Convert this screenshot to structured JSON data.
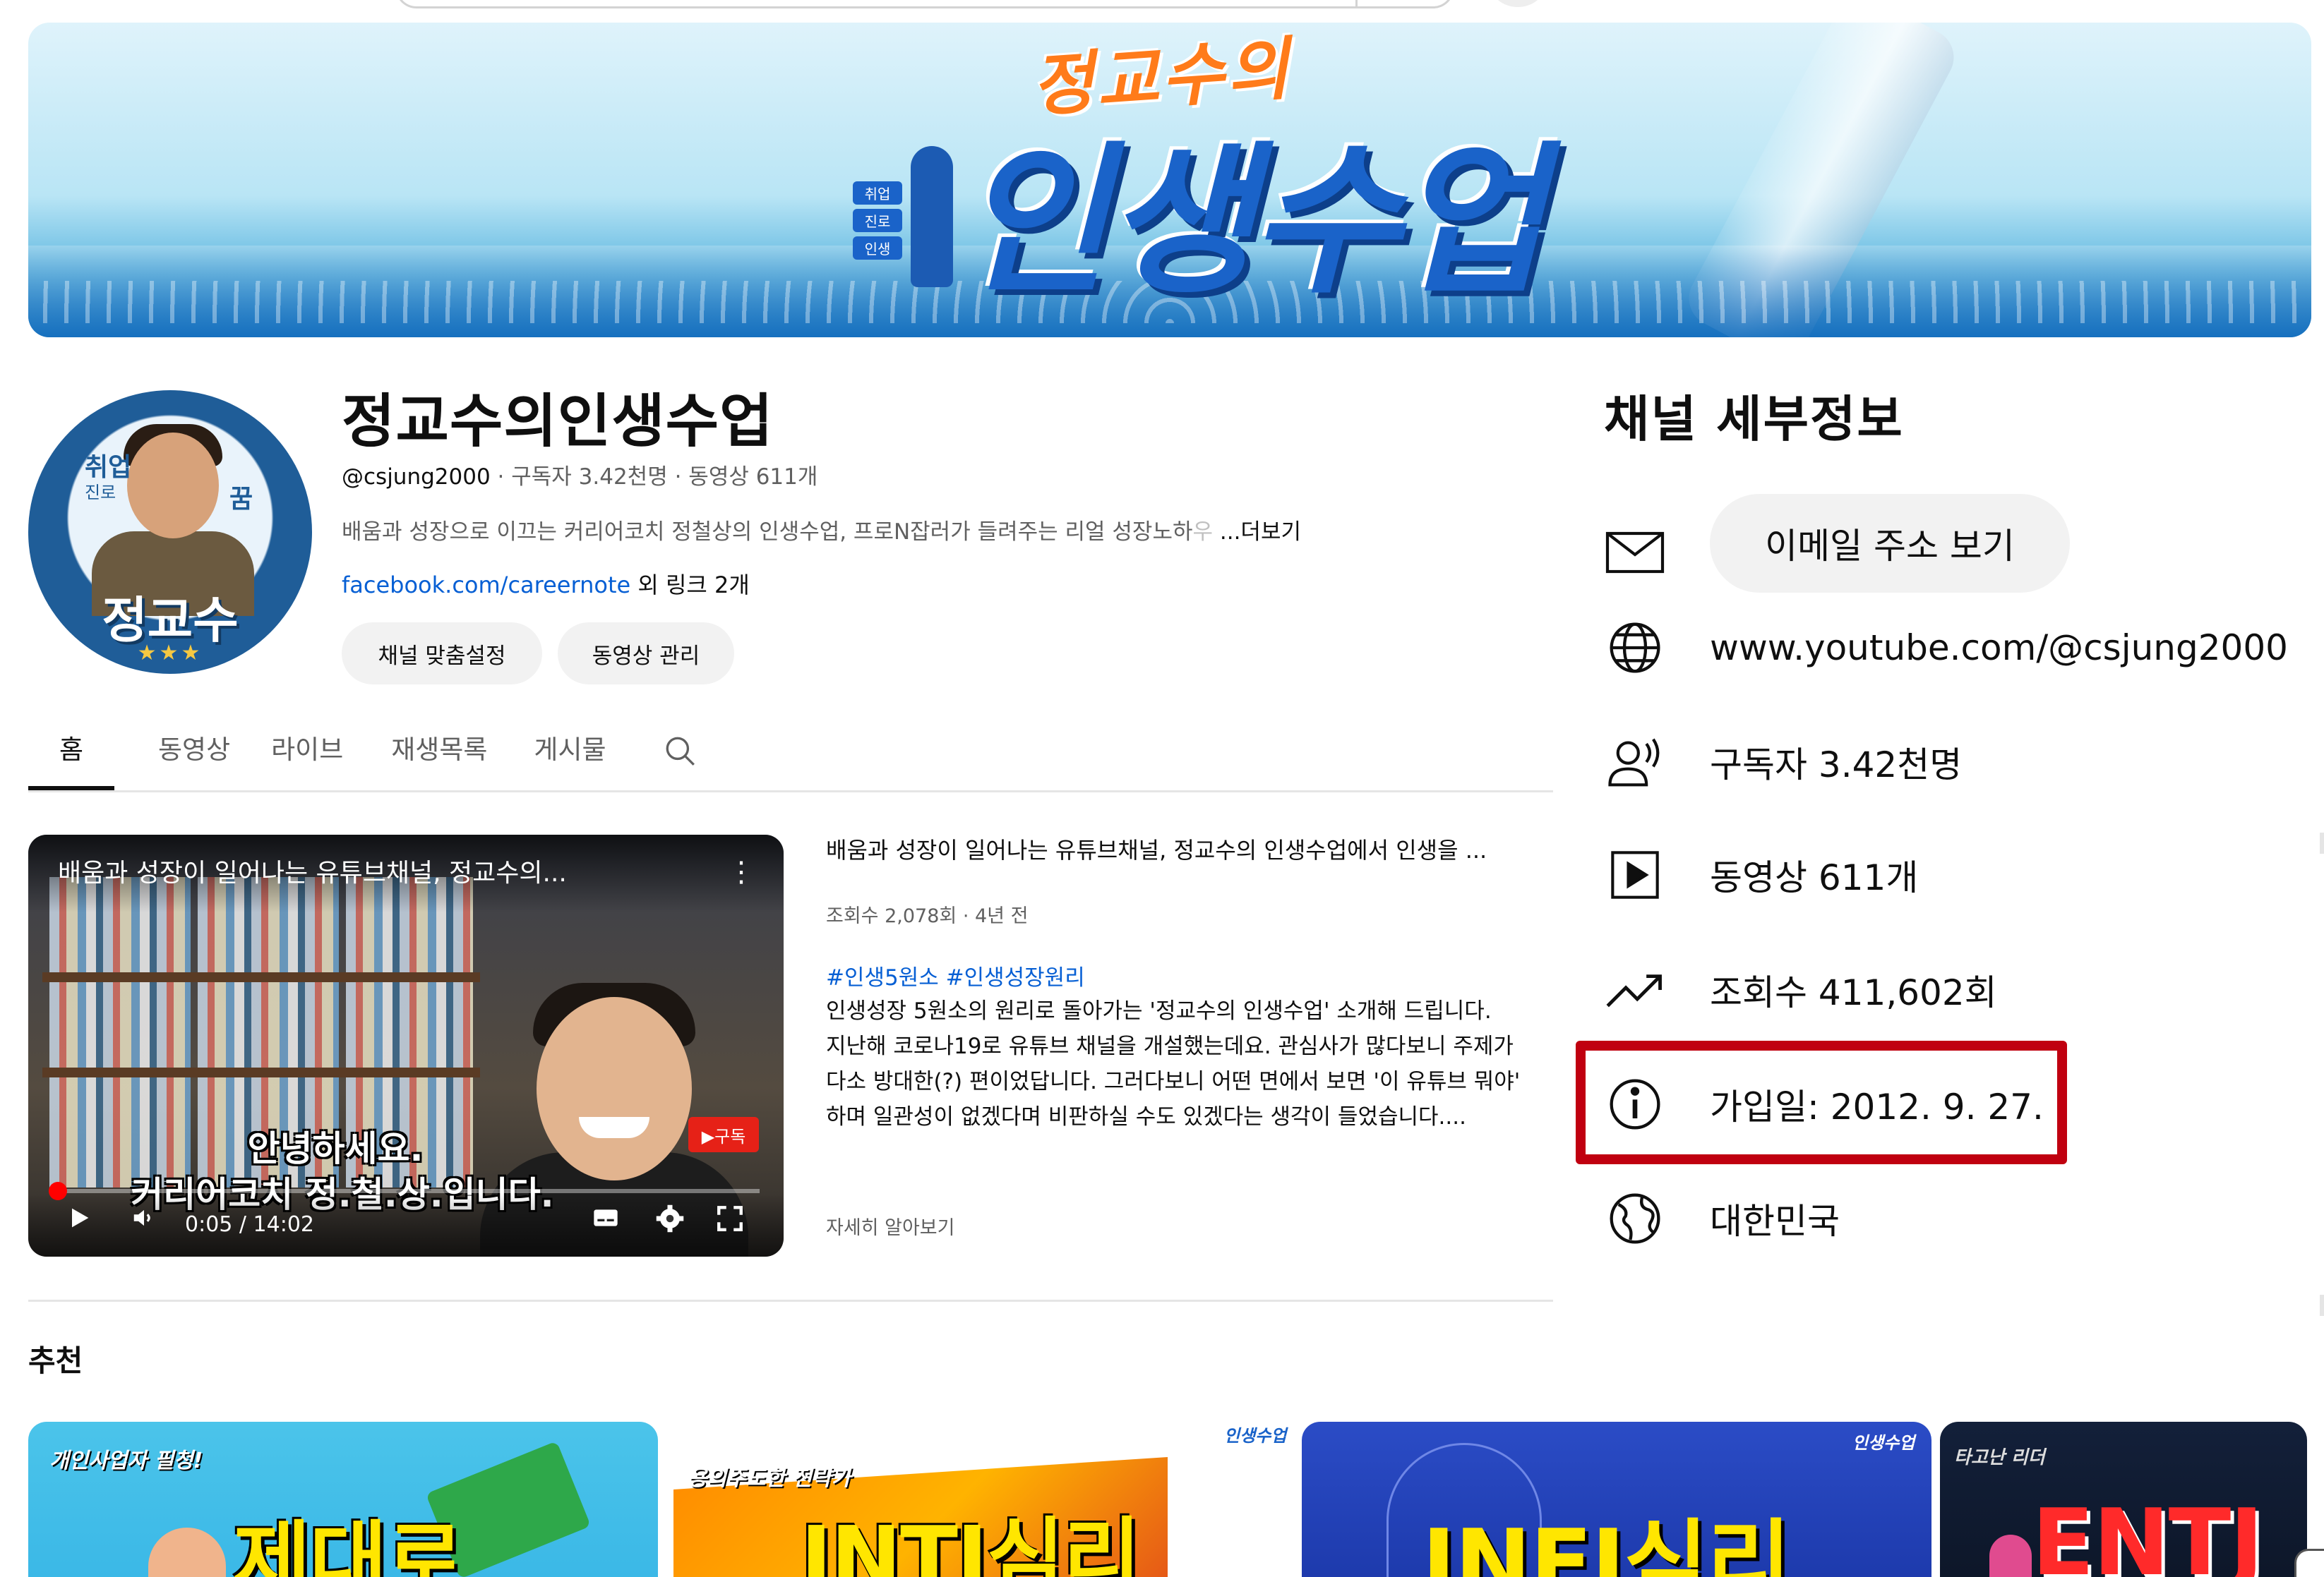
{
  "banner": {
    "subtitle": "정교수의",
    "main_title": "인생수업",
    "sign_labels": [
      "취업",
      "진로",
      "인생"
    ]
  },
  "avatar": {
    "tag_job": "취업",
    "tag_path": "진로",
    "tag_dream": "꿈",
    "name": "정교수",
    "stars": "★★★"
  },
  "channel": {
    "title": "정교수의인생수업",
    "handle": "@csjung2000",
    "subscribers": " · 구독자 3.42천명",
    "video_count": " · 동영상 611개",
    "description": "배움과 성장으로 이끄는 커리어코치 정철상의 인생수업, 프로N잡러가 들려주는 리얼 성장노하",
    "description_fade": "우 ",
    "more_label": "...더보기",
    "link": "facebook.com/careernote",
    "extra_links": " 외 링크 2개",
    "customize_label": "채널 맞춤설정",
    "manage_label": "동영상 관리"
  },
  "tabs": [
    {
      "label": "홈",
      "active": true
    },
    {
      "label": "동영상"
    },
    {
      "label": "라이브"
    },
    {
      "label": "재생목록"
    },
    {
      "label": "게시물"
    }
  ],
  "featured": {
    "overlay_title": "배움과 성장이 일어나는 유튜브채널, 정교수의...",
    "subtitle_line1": "안녕하세요.",
    "subtitle_line2": "커리어코치 정.철.상.입니다.",
    "subscribe_badge": "▶구독",
    "time": "0:05 / 14:02",
    "progress": 0.006,
    "title": "배움과 성장이 일어나는 유튜브채널, 정교수의 인생수업에서 인생을 ...",
    "stats": "조회수 2,078회 · 4년 전",
    "tags": "#인생5원소 #인생성장원리",
    "desc_line1": "인생성장 5원소의 원리로 돌아가는 '정교수의 인생수업' 소개해 드립니다.",
    "desc_line2": "지난해 코로나19로 유튜브 채널을 개설했는데요. 관심사가 많다보니 주제가 다소 방대한(?) 편이었답니다. 그러다보니 어떤 면에서 보면 '이 유튜브 뭐야' 하며 일관성이 없겠다며 비판하실 수도 있겠다는 생각이 들었습니다....",
    "more_label": "자세히 알아보기"
  },
  "recommended": {
    "title": "추천",
    "cards": [
      {
        "kicker": "개인사업자 필청!",
        "big": "제대로"
      },
      {
        "kicker": "용의주도한 전략가",
        "big": "INTJ심리",
        "logo": "인생수업"
      },
      {
        "big": "INFJ심리",
        "logo": "인생수업"
      },
      {
        "kicker": "타고난 리더",
        "big": "ENTJ"
      }
    ]
  },
  "details": {
    "title": "채널 세부정보",
    "email_button": "이메일 주소 보기",
    "url": "www.youtube.com/@csjung2000",
    "subscribers": "구독자 3.42천명",
    "videos": "동영상 611개",
    "views": "조회수 411,602회",
    "joined": "가입일: 2012. 9. 27.",
    "country": "대한민국"
  },
  "colors": {
    "link": "#065fd4",
    "highlight": "#c00010",
    "progress": "#ff0000"
  }
}
